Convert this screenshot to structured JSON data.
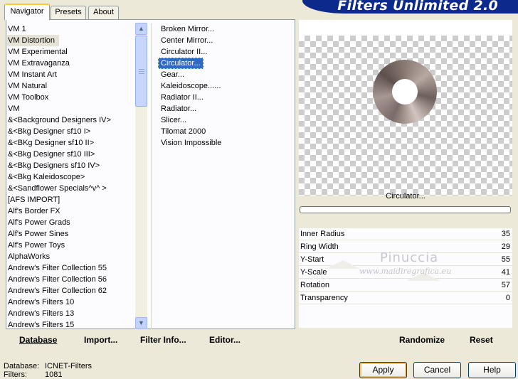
{
  "brand": "Filters Unlimited 2.0",
  "tabs": [
    {
      "label": "Navigator",
      "active": true
    },
    {
      "label": "Presets",
      "active": false
    },
    {
      "label": "About",
      "active": false
    }
  ],
  "categories": [
    "VM 1",
    "VM Distortion",
    "VM Experimental",
    "VM Extravaganza",
    "VM Instant Art",
    "VM Natural",
    "VM Toolbox",
    "VM",
    "&<Background Designers IV>",
    "&<Bkg Designer sf10 I>",
    "&<BKg Designer sf10 II>",
    "&<Bkg Designer sf10 III>",
    "&<Bkg Designers sf10 IV>",
    "&<Bkg Kaleidoscope>",
    "&<Sandflower Specials^v^ >",
    "[AFS IMPORT]",
    "Alf's Border FX",
    "Alf's Power Grads",
    "Alf's Power Sines",
    "Alf's Power Toys",
    "AlphaWorks",
    "Andrew's Filter Collection 55",
    "Andrew's Filter Collection 56",
    "Andrew's Filter Collection 62",
    "Andrew's Filters 10",
    "Andrew's Filters 13",
    "Andrew's Filters 15"
  ],
  "selected_category": "VM Distortion",
  "filters": [
    "Broken Mirror...",
    "Center Mirror...",
    "Circulator II...",
    "Circulator...",
    "Gear...",
    "Kaleidoscope......",
    "Radiator II...",
    "Radiator...",
    "Slicer...",
    "Tilomat 2000",
    "Vision Impossible"
  ],
  "selected_filter": "Circulator...",
  "panel_buttons": {
    "database": "Database",
    "import": "Import...",
    "filter_info": "Filter Info...",
    "editor": "Editor..."
  },
  "preview_title": "Circulator...",
  "params": [
    {
      "name": "Inner Radius",
      "value": "35"
    },
    {
      "name": "Ring Width",
      "value": "29"
    },
    {
      "name": "Y-Start",
      "value": "55"
    },
    {
      "name": "Y-Scale",
      "value": "41"
    },
    {
      "name": "Rotation",
      "value": "57"
    },
    {
      "name": "Transparency",
      "value": "0"
    }
  ],
  "watermark": {
    "line1": "Pinuccia",
    "line2": "www.maidiregrafica.eu"
  },
  "right_buttons": {
    "randomize": "Randomize",
    "reset": "Reset"
  },
  "footer": {
    "database_label": "Database:",
    "database_value": "ICNET-Filters",
    "filters_label": "Filters:",
    "filters_value": "1081"
  },
  "dialog_buttons": {
    "apply": "Apply",
    "cancel": "Cancel",
    "help": "Help"
  },
  "icons": {
    "scroll_up": "scroll-up-arrow-icon",
    "scroll_down": "scroll-down-arrow-icon"
  },
  "colors": {
    "selection": "#316ac5",
    "brand_bg": "#0b2a8c",
    "window_bg": "#ece9d8"
  }
}
